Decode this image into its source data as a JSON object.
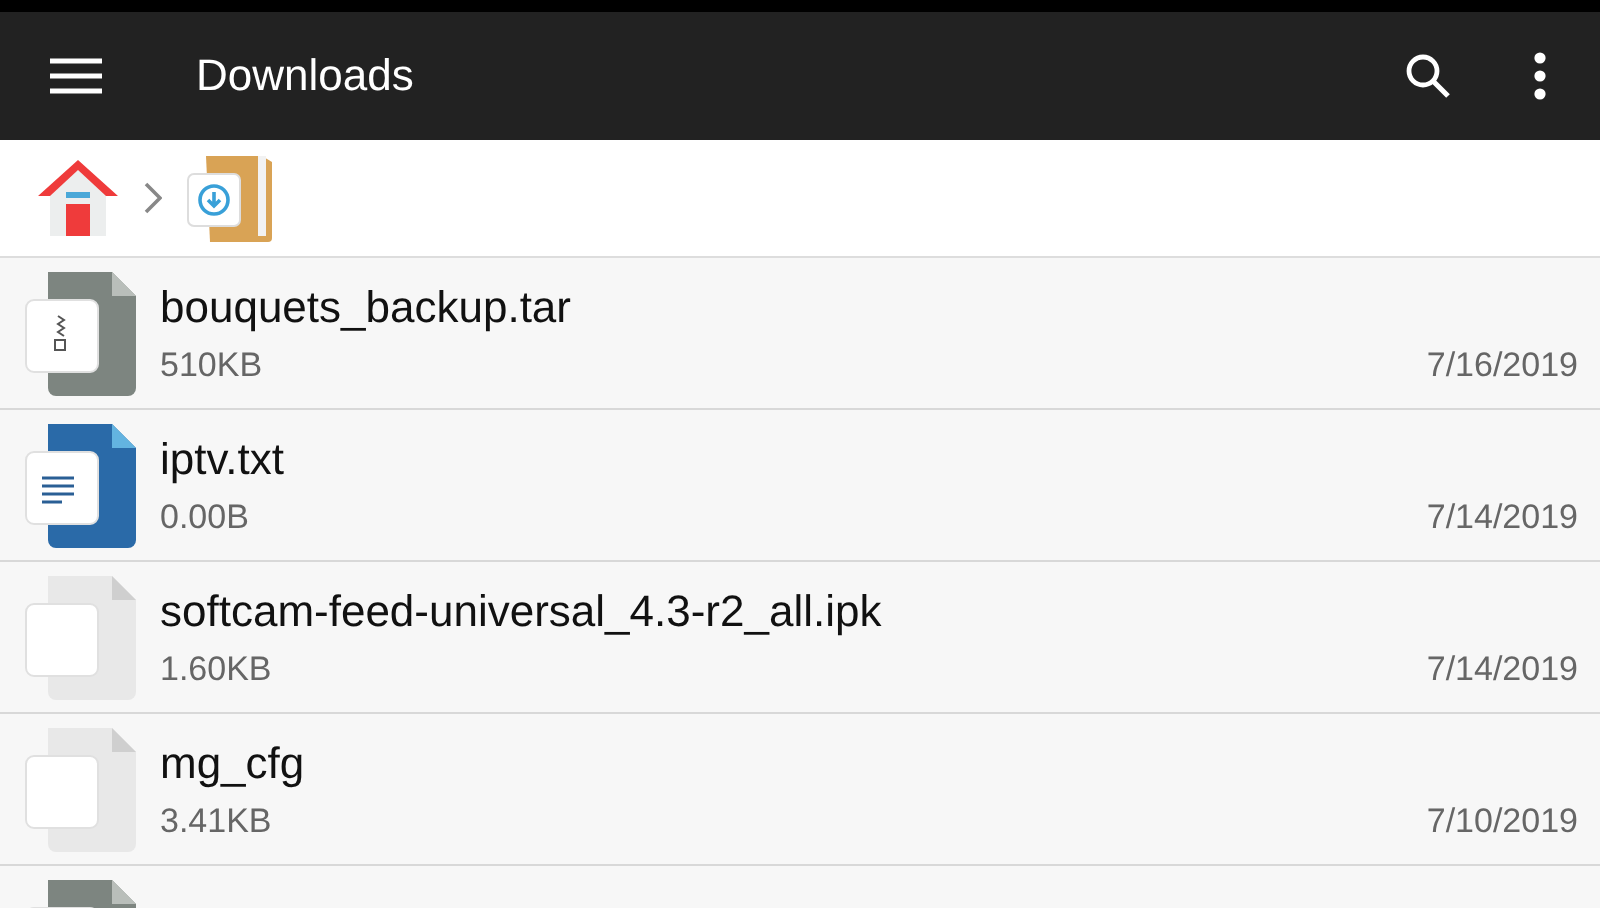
{
  "toolbar": {
    "title": "Downloads"
  },
  "breadcrumb": [
    {
      "kind": "home"
    },
    {
      "kind": "download-folder"
    }
  ],
  "files": [
    {
      "kind": "archive",
      "name": "bouquets_backup.tar",
      "size": "510KB",
      "date": "7/16/2019"
    },
    {
      "kind": "text",
      "name": "iptv.txt",
      "size": "0.00B",
      "date": "7/14/2019"
    },
    {
      "kind": "blank",
      "name": "softcam-feed-universal_4.3-r2_all.ipk",
      "size": "1.60KB",
      "date": "7/14/2019"
    },
    {
      "kind": "blank",
      "name": "mg_cfg",
      "size": "3.41KB",
      "date": "7/10/2019"
    },
    {
      "kind": "archive"
    }
  ]
}
